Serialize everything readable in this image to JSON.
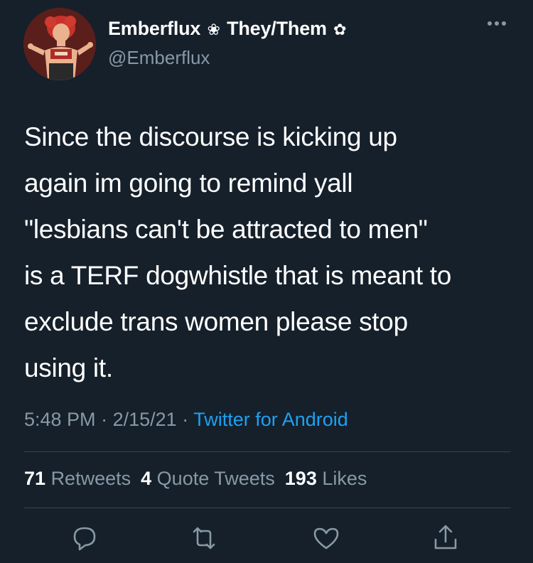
{
  "author": {
    "display_name": "Emberflux",
    "flower_one": "❀",
    "pronouns": "They/Them",
    "flower_two": "✿",
    "handle": "@Emberflux"
  },
  "tweet": {
    "lines": [
      "Since the discourse is kicking up",
      "again im going to remind yall",
      "\"lesbians can't be attracted to men\"",
      "is a TERF dogwhistle that is meant to",
      "exclude trans women please stop",
      "using it."
    ],
    "time": "5:48 PM",
    "date": "2/15/21",
    "separator": "·",
    "source": "Twitter for Android"
  },
  "stats": {
    "retweets_count": "71",
    "retweets_label": "Retweets",
    "quotes_count": "4",
    "quotes_label": "Quote Tweets",
    "likes_count": "193",
    "likes_label": "Likes"
  },
  "icons": {
    "more": "more-horizontal-icon",
    "reply": "reply-icon",
    "retweet": "retweet-icon",
    "like": "heart-icon",
    "share": "share-icon"
  },
  "colors": {
    "background": "#15202b",
    "text": "#ffffff",
    "secondary": "#8899a6",
    "link": "#1da1f2",
    "divider": "#38444d"
  }
}
